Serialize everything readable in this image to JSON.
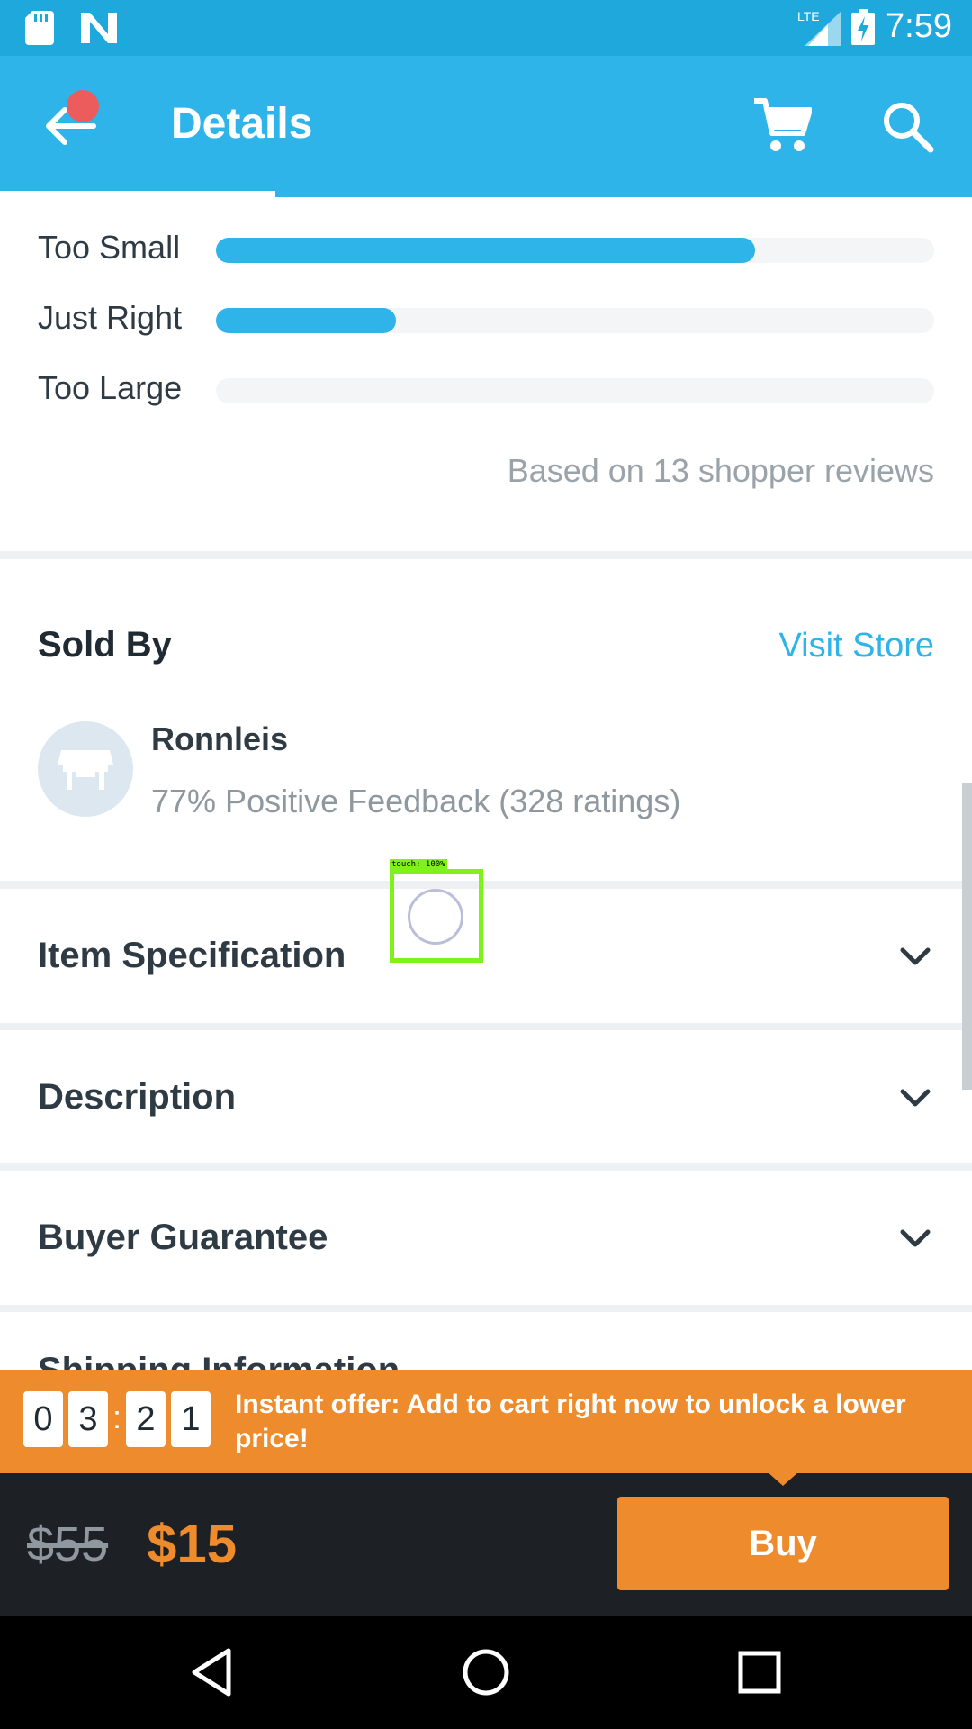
{
  "status_bar": {
    "time": "7:59",
    "network_label": "LTE",
    "icons": [
      "sd-card-icon",
      "n-logo-icon",
      "signal-icon",
      "battery-charging-icon"
    ]
  },
  "app_bar": {
    "title": "Details",
    "icons": [
      "back-arrow-icon",
      "cart-icon",
      "search-icon"
    ],
    "accent_color": "#2eb4e8"
  },
  "fit": {
    "rows": [
      {
        "label": "Too Small",
        "fraction": 0.75
      },
      {
        "label": "Just Right",
        "fraction": 0.25
      },
      {
        "label": "Too Large",
        "fraction": 0.0
      }
    ],
    "note": "Based on 13 shopper reviews"
  },
  "sold_by": {
    "title": "Sold By",
    "visit_store_label": "Visit Store",
    "seller_name": "Ronnleis",
    "feedback": "77% Positive Feedback (328 ratings)",
    "avatar_icon": "storefront-icon"
  },
  "sections": [
    {
      "title": "Item Specification"
    },
    {
      "title": "Description"
    },
    {
      "title": "Buyer Guarantee"
    }
  ],
  "partial_section": "Shipping Information",
  "touch_overlay": {
    "label": "touch: 100%"
  },
  "offer": {
    "digits": [
      "0",
      "3",
      "2",
      "1"
    ],
    "separator": ":",
    "text": "Instant offer: Add to cart right now to unlock a lower price!",
    "color": "#ee8b2c"
  },
  "purchase": {
    "old_price": "$55",
    "new_price": "$15",
    "buy_label": "Buy"
  },
  "nav_bar": {
    "icons": [
      "back-triangle-icon",
      "home-circle-icon",
      "recents-square-icon"
    ]
  }
}
